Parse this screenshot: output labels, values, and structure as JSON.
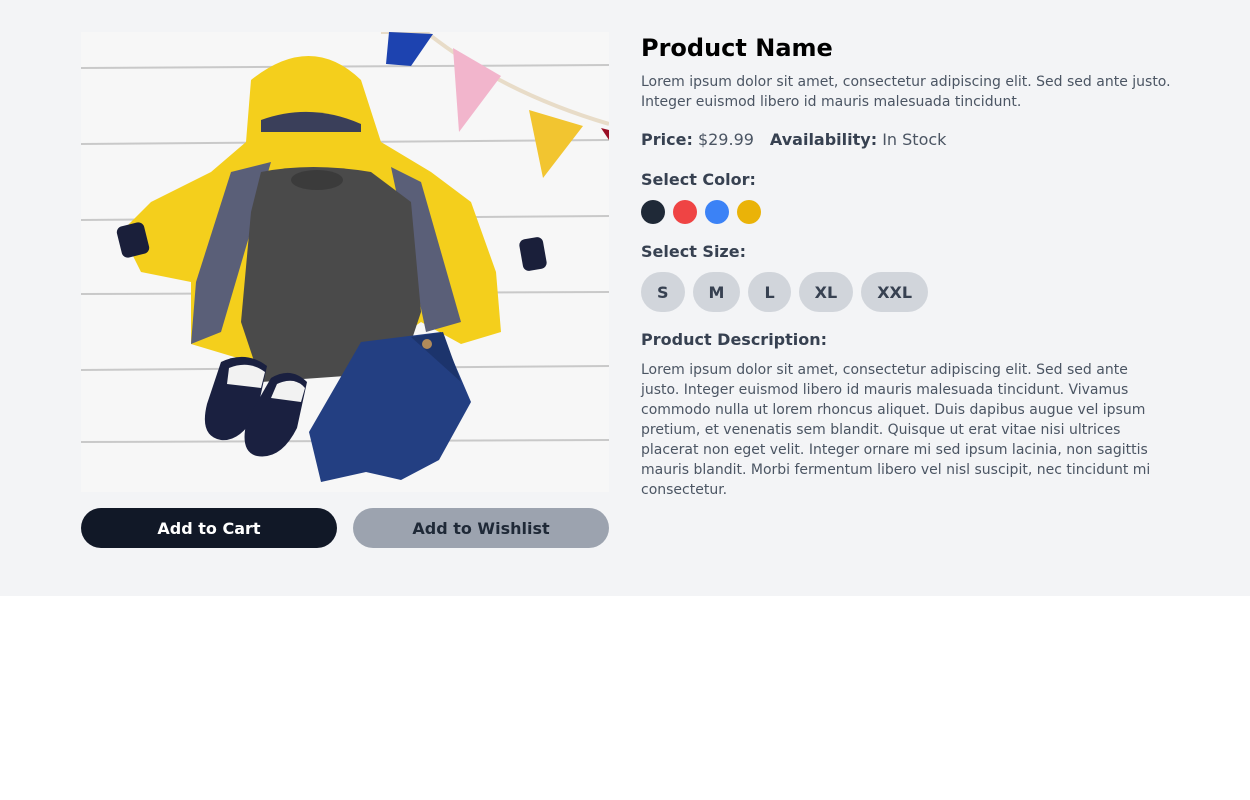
{
  "product": {
    "name": "Product Name",
    "subtitle": "Lorem ipsum dolor sit amet, consectetur adipiscing elit. Sed sed ante justo. Integer euismod libero id mauris malesuada tincidunt.",
    "price_label": "Price:",
    "price": "$29.99",
    "availability_label": "Availability:",
    "availability": "In Stock",
    "image_icon": "kids-outfit-photo"
  },
  "colors": {
    "label": "Select Color:",
    "options": [
      "#1f2937",
      "#ef4444",
      "#3b82f6",
      "#eab308"
    ]
  },
  "sizes": {
    "label": "Select Size:",
    "options": [
      "S",
      "M",
      "L",
      "XL",
      "XXL"
    ]
  },
  "description": {
    "label": "Product Description:",
    "text": "Lorem ipsum dolor sit amet, consectetur adipiscing elit. Sed sed ante justo. Integer euismod libero id mauris malesuada tincidunt. Vivamus commodo nulla ut lorem rhoncus aliquet. Duis dapibus augue vel ipsum pretium, et venenatis sem blandit. Quisque ut erat vitae nisi ultrices placerat non eget velit. Integer ornare mi sed ipsum lacinia, non sagittis mauris blandit. Morbi fermentum libero vel nisl suscipit, nec tincidunt mi consectetur."
  },
  "actions": {
    "add_to_cart": "Add to Cart",
    "add_to_wishlist": "Add to Wishlist"
  }
}
